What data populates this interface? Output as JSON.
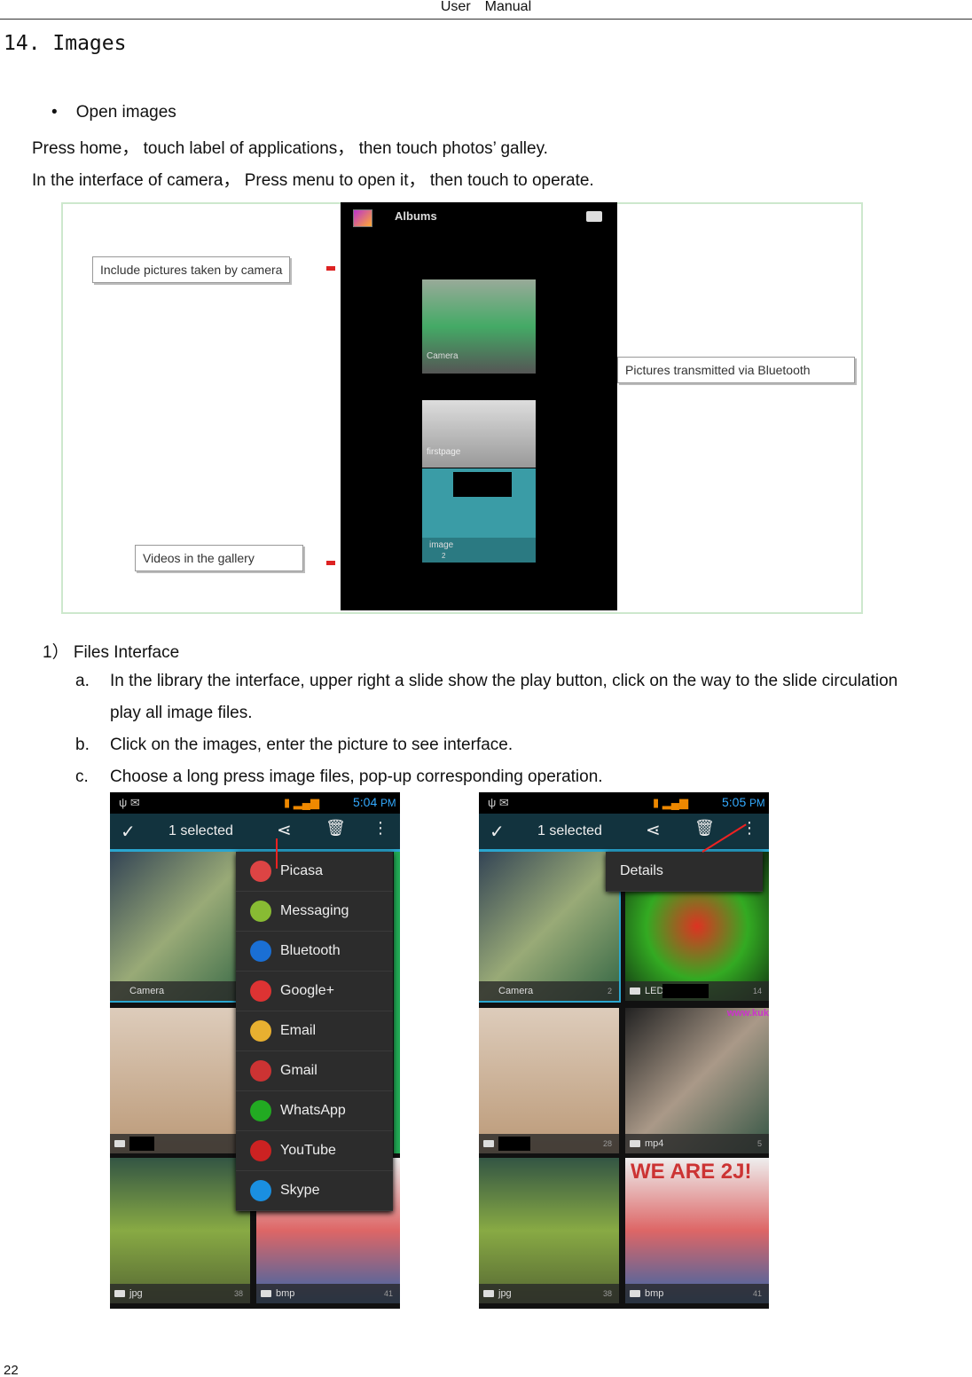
{
  "header": {
    "left": "User",
    "right": "Manual"
  },
  "section_title": "14.  Images",
  "bullet": "Open images",
  "intro_lines": [
    "Press home， touch label of applications， then touch photos’ galley.",
    "In the interface of camera， Press menu to open it， then touch to operate."
  ],
  "figure1": {
    "callouts": [
      "Include pictures taken by camera",
      "Pictures transmitted via Bluetooth",
      "Videos in the gallery"
    ],
    "app_title": "Albums",
    "albums": [
      {
        "name": "Camera"
      },
      {
        "name": "firstpage"
      },
      {
        "name": "image",
        "count": "2"
      }
    ]
  },
  "files_heading": {
    "num": "1）",
    "label": "Files Interface"
  },
  "list": [
    {
      "marker": "a.",
      "text": "In the library the interface, upper right a slide show the play button, click on the way to the slide circulation",
      "cont": "play all image files."
    },
    {
      "marker": "b.",
      "text": "Click on the images, enter the picture to see interface."
    },
    {
      "marker": "c.",
      "text": "Choose a long press image files, pop-up corresponding operation."
    }
  ],
  "phone_left": {
    "time": "5:04",
    "ampm": "PM",
    "selected": "1 selected",
    "tiles": [
      {
        "name": "Camera"
      },
      {
        "name": "",
        "count": ""
      },
      {
        "name": "jpg",
        "count": "38"
      },
      {
        "name": "bmp",
        "count": "41"
      }
    ],
    "share_menu": [
      "Picasa",
      "Messaging",
      "Bluetooth",
      "Google+",
      "Email",
      "Gmail",
      "WhatsApp",
      "YouTube",
      "Skype"
    ],
    "share_colors": [
      "#d44",
      "#8b3",
      "#1a6fd4",
      "#d33",
      "#e8b030",
      "#c33",
      "#2a2",
      "#c22",
      "#1a8fe0"
    ]
  },
  "phone_right": {
    "time": "5:05",
    "ampm": "PM",
    "selected": "1 selected",
    "popup": "Details",
    "tiles": [
      {
        "name": "Camera",
        "count": "2"
      },
      {
        "name": "LED",
        "count": "14"
      },
      {
        "name": "",
        "count": "28"
      },
      {
        "name": "mp4",
        "count": "5"
      },
      {
        "name": "jpg",
        "count": "38"
      },
      {
        "name": "bmp",
        "count": "41"
      }
    ],
    "overlay_text": "WE ARE 2J!",
    "watermark": "www.kuk"
  },
  "page_number": "22"
}
